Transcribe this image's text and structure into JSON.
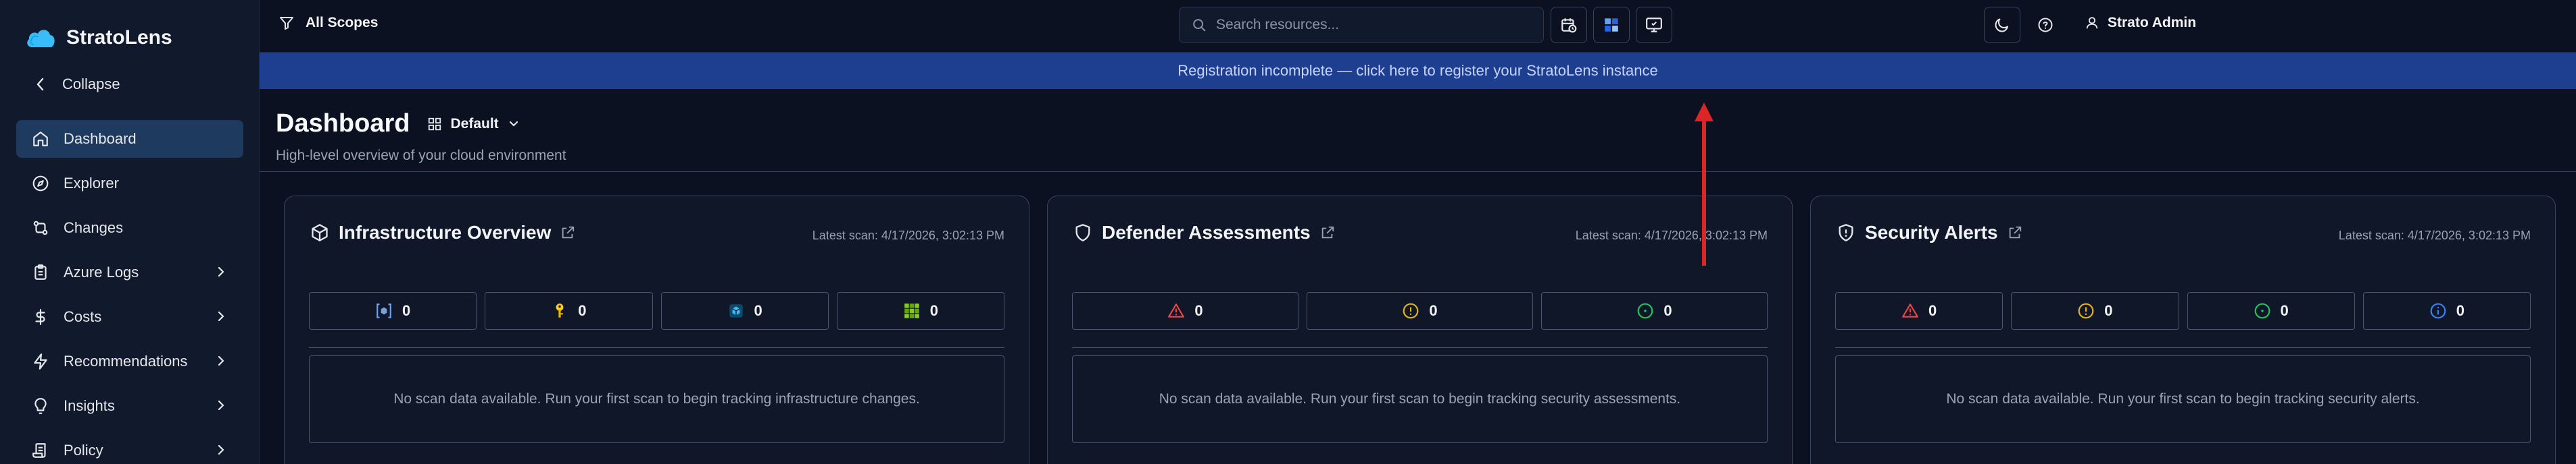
{
  "brand": {
    "name": "StratoLens"
  },
  "sidebar": {
    "collapse_label": "Collapse",
    "items": [
      {
        "label": "Dashboard",
        "icon": "home-icon",
        "active": true,
        "has_children": false
      },
      {
        "label": "Explorer",
        "icon": "compass-icon",
        "active": false,
        "has_children": false
      },
      {
        "label": "Changes",
        "icon": "git-compare-icon",
        "active": false,
        "has_children": false
      },
      {
        "label": "Azure Logs",
        "icon": "clipboard-list-icon",
        "active": false,
        "has_children": true
      },
      {
        "label": "Costs",
        "icon": "dollar-icon",
        "active": false,
        "has_children": true
      },
      {
        "label": "Recommendations",
        "icon": "zap-icon",
        "active": false,
        "has_children": true
      },
      {
        "label": "Insights",
        "icon": "lightbulb-icon",
        "active": false,
        "has_children": true
      },
      {
        "label": "Policy",
        "icon": "scroll-icon",
        "active": false,
        "has_children": true
      }
    ]
  },
  "topbar": {
    "scope_label": "All Scopes",
    "search_placeholder": "Search resources...",
    "user_name": "Strato Admin"
  },
  "banner": {
    "text": "Registration incomplete — click here to register your StratoLens instance"
  },
  "page": {
    "title": "Dashboard",
    "layout_label": "Default",
    "subtitle": "High-level overview of your cloud environment"
  },
  "cards": [
    {
      "title": "Infrastructure Overview",
      "scan": "Latest scan: 4/17/2026, 3:02:13 PM",
      "stats": [
        {
          "icon": "resource-group-icon",
          "value": "0"
        },
        {
          "icon": "key-icon",
          "value": "0"
        },
        {
          "icon": "vm-cube-icon",
          "value": "0"
        },
        {
          "icon": "grid-icon",
          "value": "0"
        }
      ],
      "empty_text": "No scan data available. Run your first scan to begin tracking infrastructure changes."
    },
    {
      "title": "Defender Assessments",
      "scan": "Latest scan: 4/17/2026, 3:02:13 PM",
      "stats": [
        {
          "icon": "triangle-alert-icon",
          "value": "0"
        },
        {
          "icon": "circle-alert-icon",
          "value": "0"
        },
        {
          "icon": "circle-check-icon",
          "value": "0"
        }
      ],
      "empty_text": "No scan data available. Run your first scan to begin tracking security assessments."
    },
    {
      "title": "Security Alerts",
      "scan": "Latest scan: 4/17/2026, 3:02:13 PM",
      "stats": [
        {
          "icon": "triangle-alert-icon",
          "value": "0"
        },
        {
          "icon": "circle-alert-icon",
          "value": "0"
        },
        {
          "icon": "circle-check-icon",
          "value": "0"
        },
        {
          "icon": "circle-info-icon",
          "value": "0"
        }
      ],
      "empty_text": "No scan data available. Run your first scan to begin tracking security alerts."
    }
  ],
  "colors": {
    "accent": "#1e3f8f",
    "active_nav": "#1e3a5f",
    "danger": "#ef4444",
    "warning": "#eab308",
    "success": "#22c55e",
    "info": "#3b82f6",
    "annotation_arrow": "#dc2626"
  }
}
